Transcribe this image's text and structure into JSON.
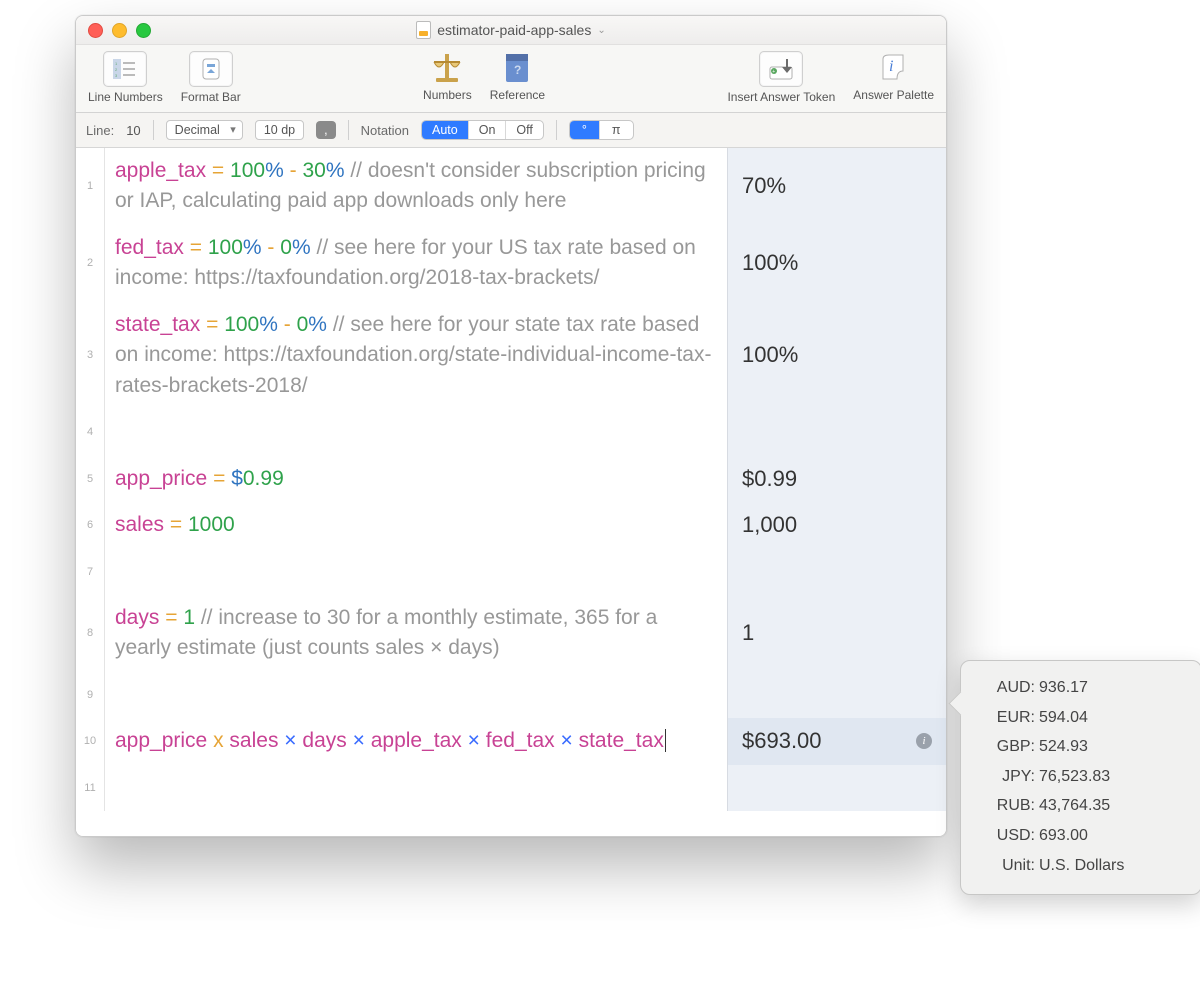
{
  "window": {
    "title": "estimator-paid-app-sales"
  },
  "toolbar": {
    "line_numbers": "Line Numbers",
    "format_bar": "Format Bar",
    "numbers": "Numbers",
    "reference": "Reference",
    "insert_answer_token": "Insert Answer Token",
    "answer_palette": "Answer Palette"
  },
  "format_row": {
    "line_label": "Line:",
    "line_value": "10",
    "mode": "Decimal",
    "precision": "10 dp",
    "comma": ",",
    "notation_label": "Notation",
    "notation_options": [
      "Auto",
      "On",
      "Off"
    ],
    "notation_selected": "Auto",
    "angle_options": [
      "°",
      "π"
    ],
    "angle_selected": "°"
  },
  "lines": [
    {
      "n": 1,
      "tokens": [
        {
          "t": "apple_tax",
          "c": "id"
        },
        {
          "t": " "
        },
        {
          "t": "=",
          "c": "eq"
        },
        {
          "t": " "
        },
        {
          "t": "100",
          "c": "nm"
        },
        {
          "t": "%",
          "c": "un"
        },
        {
          "t": " "
        },
        {
          "t": "-",
          "c": "eq"
        },
        {
          "t": " "
        },
        {
          "t": "30",
          "c": "nm"
        },
        {
          "t": "%",
          "c": "un"
        },
        {
          "t": " "
        },
        {
          "t": "// doesn't consider subscription pricing or IAP, calculating paid app downloads only here",
          "c": "cm"
        }
      ],
      "result": "70%"
    },
    {
      "n": 2,
      "tokens": [
        {
          "t": "fed_tax",
          "c": "id"
        },
        {
          "t": " "
        },
        {
          "t": "=",
          "c": "eq"
        },
        {
          "t": " "
        },
        {
          "t": "100",
          "c": "nm"
        },
        {
          "t": "%",
          "c": "un"
        },
        {
          "t": " "
        },
        {
          "t": "-",
          "c": "eq"
        },
        {
          "t": " "
        },
        {
          "t": "0",
          "c": "nm"
        },
        {
          "t": "%",
          "c": "un"
        },
        {
          "t": " "
        },
        {
          "t": "// see here for your US tax rate based on income: https://taxfoundation.org/2018-tax-brackets/",
          "c": "cm"
        }
      ],
      "result": "100%"
    },
    {
      "n": 3,
      "tokens": [
        {
          "t": "state_tax",
          "c": "id"
        },
        {
          "t": " "
        },
        {
          "t": "=",
          "c": "eq"
        },
        {
          "t": " "
        },
        {
          "t": "100",
          "c": "nm"
        },
        {
          "t": "%",
          "c": "un"
        },
        {
          "t": " "
        },
        {
          "t": "-",
          "c": "eq"
        },
        {
          "t": " "
        },
        {
          "t": "0",
          "c": "nm"
        },
        {
          "t": "%",
          "c": "un"
        },
        {
          "t": " "
        },
        {
          "t": "// see here for your state tax rate based on income: https://taxfoundation.org/state-individual-income-tax-rates-brackets-2018/",
          "c": "cm"
        }
      ],
      "result": "100%"
    },
    {
      "n": 4,
      "tokens": [],
      "result": ""
    },
    {
      "n": 5,
      "tokens": [
        {
          "t": "app_price",
          "c": "id"
        },
        {
          "t": " "
        },
        {
          "t": "=",
          "c": "eq"
        },
        {
          "t": " "
        },
        {
          "t": "$",
          "c": "un"
        },
        {
          "t": "0.99",
          "c": "nm"
        }
      ],
      "result": "$0.99"
    },
    {
      "n": 6,
      "tokens": [
        {
          "t": "sales",
          "c": "id"
        },
        {
          "t": " "
        },
        {
          "t": "=",
          "c": "eq"
        },
        {
          "t": " "
        },
        {
          "t": "1000",
          "c": "nm"
        }
      ],
      "result": "1,000"
    },
    {
      "n": 7,
      "tokens": [],
      "result": ""
    },
    {
      "n": 8,
      "tokens": [
        {
          "t": "days",
          "c": "id"
        },
        {
          "t": " "
        },
        {
          "t": "=",
          "c": "eq"
        },
        {
          "t": " "
        },
        {
          "t": "1",
          "c": "nm"
        },
        {
          "t": " "
        },
        {
          "t": "// increase to 30 for a monthly estimate, 365 for a yearly estimate (just counts sales × days)",
          "c": "cm"
        }
      ],
      "result": "1"
    },
    {
      "n": 9,
      "tokens": [],
      "result": ""
    },
    {
      "n": 10,
      "active": true,
      "cursor": true,
      "info": true,
      "tokens": [
        {
          "t": "app_price",
          "c": "id"
        },
        {
          "t": " "
        },
        {
          "t": "x",
          "c": "eq"
        },
        {
          "t": " "
        },
        {
          "t": "sales",
          "c": "id"
        },
        {
          "t": " "
        },
        {
          "t": "×",
          "c": "mx"
        },
        {
          "t": " "
        },
        {
          "t": "days",
          "c": "id"
        },
        {
          "t": " "
        },
        {
          "t": "×",
          "c": "mx"
        },
        {
          "t": " "
        },
        {
          "t": "apple_tax",
          "c": "id"
        },
        {
          "t": " "
        },
        {
          "t": "×",
          "c": "mx"
        },
        {
          "t": " "
        },
        {
          "t": "fed_tax",
          "c": "id"
        },
        {
          "t": " "
        },
        {
          "t": "×",
          "c": "mx"
        },
        {
          "t": " "
        },
        {
          "t": "state_tax",
          "c": "id"
        }
      ],
      "result": "$693.00"
    },
    {
      "n": 11,
      "tokens": [],
      "result": ""
    }
  ],
  "tooltip": {
    "rows": [
      {
        "k": "AUD:",
        "v": "936.17"
      },
      {
        "k": "EUR:",
        "v": "594.04"
      },
      {
        "k": "GBP:",
        "v": "524.93"
      },
      {
        "k": "JPY:",
        "v": "76,523.83"
      },
      {
        "k": "RUB:",
        "v": "43,764.35"
      },
      {
        "k": "USD:",
        "v": "693.00"
      },
      {
        "k": "Unit:",
        "v": "U.S. Dollars"
      }
    ]
  }
}
